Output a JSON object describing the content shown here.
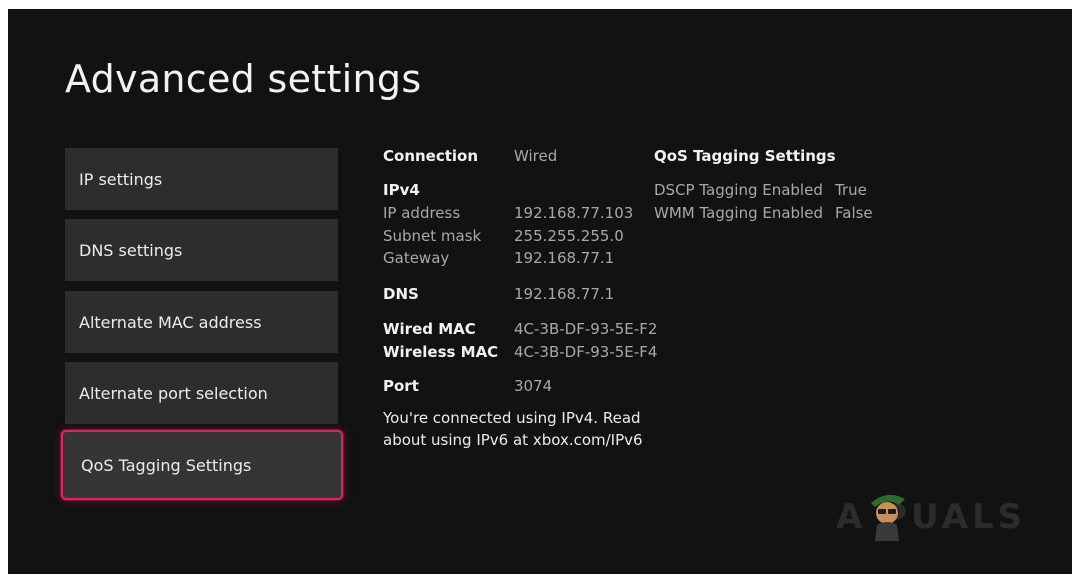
{
  "page": {
    "title": "Advanced settings"
  },
  "menu": {
    "items": [
      {
        "label": "IP settings"
      },
      {
        "label": "DNS settings"
      },
      {
        "label": "Alternate MAC address"
      },
      {
        "label": "Alternate port selection"
      },
      {
        "label": "QoS Tagging Settings",
        "focused": true
      }
    ]
  },
  "details": {
    "connection_label": "Connection",
    "connection_value": "Wired",
    "ipv4_heading": "IPv4",
    "ip_label": "IP address",
    "ip_value": "192.168.77.103",
    "subnet_label": "Subnet mask",
    "subnet_value": "255.255.255.0",
    "gateway_label": "Gateway",
    "gateway_value": "192.168.77.1",
    "dns_label": "DNS",
    "dns_value": "192.168.77.1",
    "wired_mac_label": "Wired MAC",
    "wired_mac_value": "4C-3B-DF-93-5E-F2",
    "wireless_mac_label": "Wireless MAC",
    "wireless_mac_value": "4C-3B-DF-93-5E-F4",
    "port_label": "Port",
    "port_value": "3074",
    "note": "You're connected using IPv4. Read about using IPv6 at xbox.com/IPv6"
  },
  "qos": {
    "heading": "QoS Tagging Settings",
    "dscp_label": "DSCP Tagging Enabled",
    "dscp_value": "True",
    "wmm_label": "WMM Tagging Enabled",
    "wmm_value": "False"
  },
  "watermark": {
    "text": "A  PUALS"
  },
  "colors": {
    "focus_border": "#e0245e",
    "background": "#121212",
    "tile": "#2d2d2d"
  }
}
